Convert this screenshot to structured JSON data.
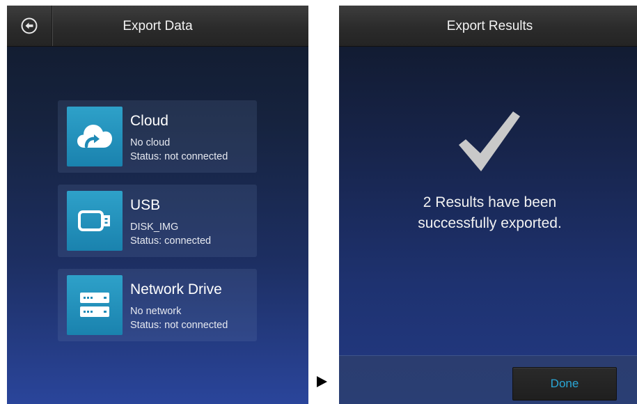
{
  "export_data": {
    "title": "Export Data",
    "back_icon": "back-arrow-circle-icon",
    "options": [
      {
        "icon": "cloud-upload-icon",
        "title": "Cloud",
        "line1": "No cloud",
        "line2": "Status: not connected"
      },
      {
        "icon": "usb-drive-icon",
        "title": "USB",
        "line1": "DISK_IMG",
        "line2": "Status: connected"
      },
      {
        "icon": "network-drive-icon",
        "title": "Network Drive",
        "line1": "No network",
        "line2": "Status: not connected"
      }
    ]
  },
  "transition_icon": "play-arrow-icon",
  "export_results": {
    "title": "Export Results",
    "icon": "checkmark-icon",
    "message_line1": "2 Results have been",
    "message_line2": "successfully exported.",
    "done_label": "Done"
  },
  "colors": {
    "accent": "#2aa7d6",
    "icon_tile": "#2494c0",
    "titlebar": "#2b2b2b",
    "background_top": "#111a2b",
    "background_bottom": "#2a459b"
  }
}
